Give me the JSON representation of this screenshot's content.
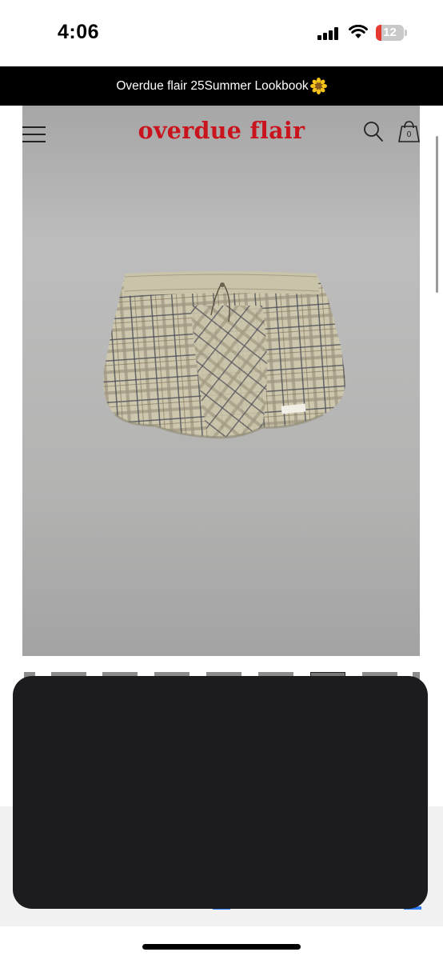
{
  "status_bar": {
    "time": "4:06",
    "battery_level": "12"
  },
  "banner": {
    "text": "Overdue flair 25Summer Lookbook",
    "emoji": "sunflower-icon"
  },
  "header": {
    "logo": "overdue flair",
    "cart_count": "0"
  },
  "product": {
    "image_label": "plaid bubble shorts",
    "tag_text": "overdue flair"
  },
  "colors": {
    "logo_red": "#c9141e",
    "banner_bg": "#000000",
    "panel_bg": "#1c1c1e"
  }
}
